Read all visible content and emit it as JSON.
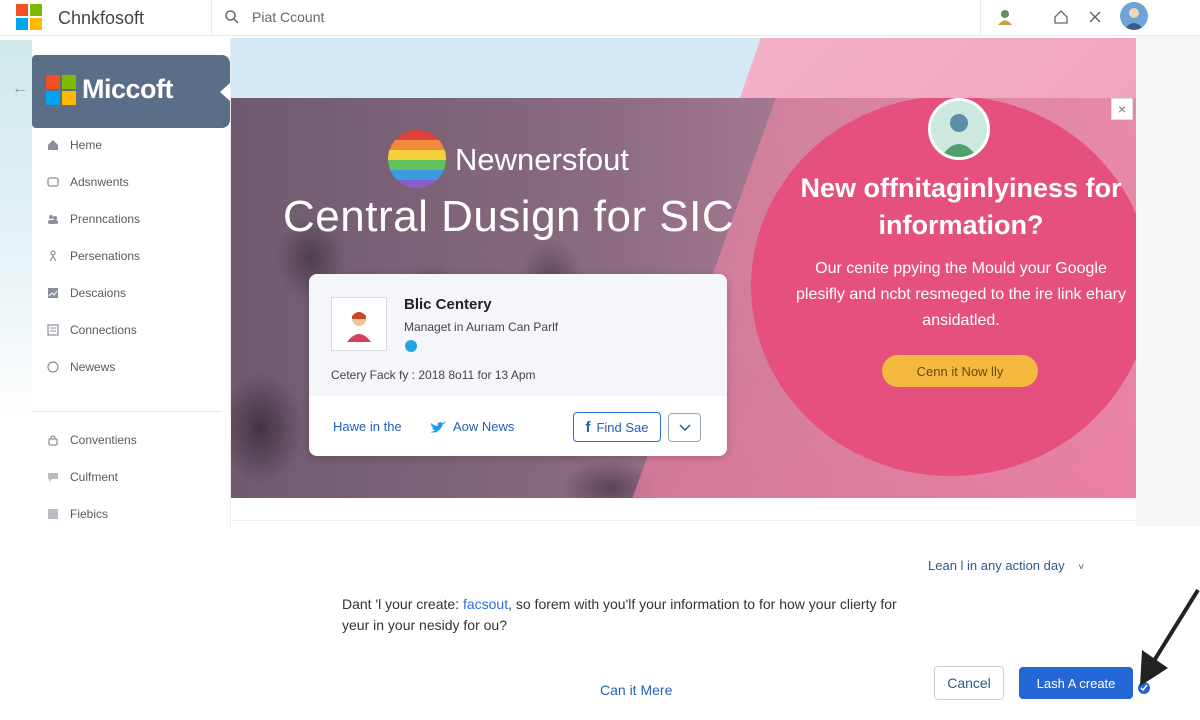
{
  "app": {
    "name": "Chnkfosoft",
    "colors": {
      "blue": "#2566d6",
      "pink": "#e5507f",
      "yellow": "#f5b940",
      "sidebar_brand": "#5a6e87"
    }
  },
  "search": {
    "placeholder": "Piat Ccount"
  },
  "topbar": {
    "icons": [
      "user-icon",
      "home-icon",
      "close-icon",
      "avatar"
    ]
  },
  "sidebar": {
    "brand": "Miccoft",
    "items": [
      {
        "label": "Heme",
        "icon": "home-icon"
      },
      {
        "label": "Adsnwents",
        "icon": "shield-icon"
      },
      {
        "label": "Prenncations",
        "icon": "users-icon"
      },
      {
        "label": "Persenations",
        "icon": "person-icon"
      },
      {
        "label": "Descaions",
        "icon": "image-icon"
      },
      {
        "label": "Connections",
        "icon": "list-icon"
      },
      {
        "label": "Newews",
        "icon": "circle-icon"
      }
    ],
    "secondary": [
      {
        "label": "Conventiens",
        "icon": "lock-icon"
      },
      {
        "label": "Culfment",
        "icon": "chat-icon"
      },
      {
        "label": "Fiebics",
        "icon": "square-icon"
      }
    ]
  },
  "hero": {
    "brand": "Newnersfout",
    "title": "Central Dusign for SIC"
  },
  "promo": {
    "title": "New offnitaginlyiness for information?",
    "body": "Our cenite ppying the Mould your Google plesifly and ncbt resmeged to the ire link ehary ansidatled.",
    "button": "Cenn it Now lly"
  },
  "card": {
    "name": "Blic Centery",
    "role": "Managet in Aurıam Can Parlf",
    "date": "Cetery Fack fy : 2018 8o11 for 13 Apm",
    "link": "Hawe in the",
    "twitter": "Aow News",
    "facebook": "Find Sae"
  },
  "dialog": {
    "action_day": "Lean l in any action day",
    "text_before": "Dant 'l your create: ",
    "text_link": "facsout",
    "text_after": ", so forem with you'lf your information to for how your clierty for yeur in your nesidy for ou?",
    "more_link": "Can it Mere",
    "cancel": "Cancel",
    "create": "Lash A create"
  }
}
